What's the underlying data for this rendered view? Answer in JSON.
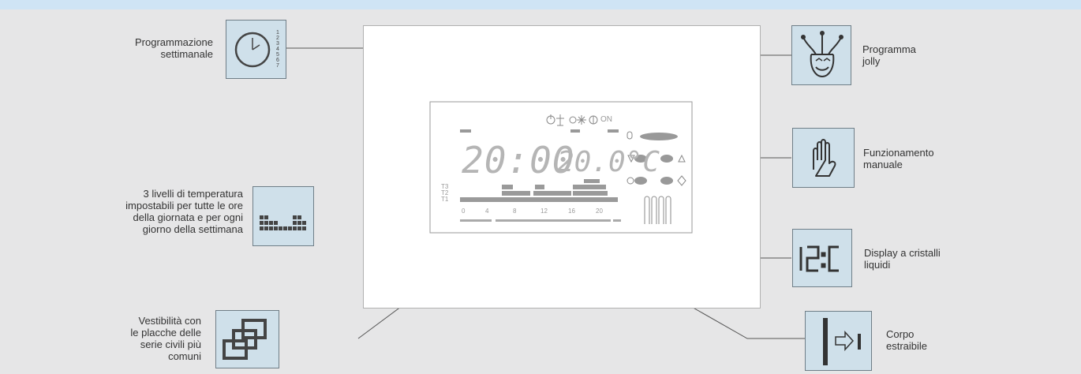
{
  "colors": {
    "background": "#e6e6e7",
    "topbar": "#cfe4f5",
    "icon_fill": "#cfe0ea",
    "line": "#555555"
  },
  "callouts": {
    "weekly_programming": {
      "line1": "Programmazione",
      "line2": "settimanale",
      "digits": [
        "1",
        "2",
        "3",
        "4",
        "5",
        "6",
        "7"
      ]
    },
    "temperature_levels": {
      "line1": "3 livelli di temperatura",
      "line2": "impostabili per tutte le ore",
      "line3": "della giornata e per ogni",
      "line4": "giorno della settimana"
    },
    "compatibility": {
      "line1": "Vestibilità con",
      "line2": "le placche delle",
      "line3": "serie civili più",
      "line4": "comuni"
    },
    "jolly_program": {
      "line1": "Programma",
      "line2": "jolly"
    },
    "manual_operation": {
      "line1": "Funzionamento",
      "line2": "manuale"
    },
    "lcd_display": {
      "line1": "Display a cristalli",
      "line2": "liquidi",
      "icon_text": "12:0"
    },
    "removable_body": {
      "line1": "Corpo",
      "line2": "estraibile"
    }
  },
  "display": {
    "time": "20:00",
    "temperature": "20.0",
    "unit": "°C",
    "mode_on": "ON",
    "levels": [
      "T3",
      "T2",
      "T1"
    ],
    "hour_scale": [
      "0",
      "4",
      "8",
      "12",
      "16",
      "20"
    ]
  }
}
